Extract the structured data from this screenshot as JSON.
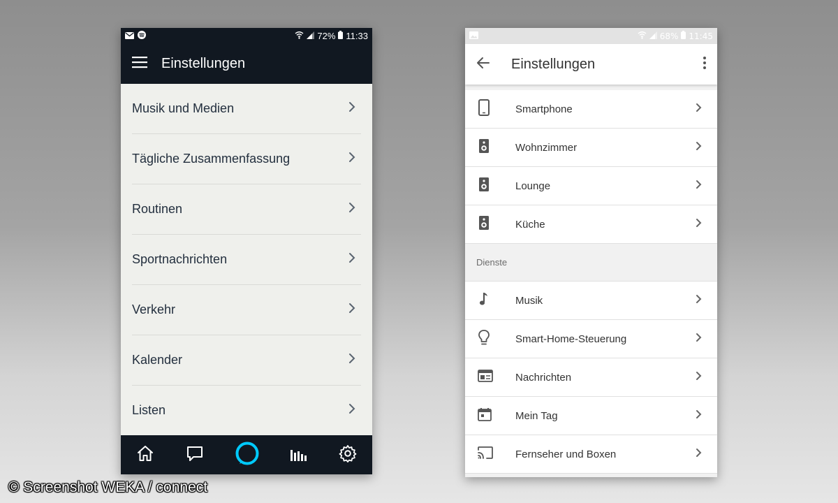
{
  "left_phone": {
    "status": {
      "battery": "72%",
      "time": "11:33"
    },
    "title": "Einstellungen",
    "items": [
      {
        "label": "Musik und Medien"
      },
      {
        "label": "Tägliche Zusammenfassung"
      },
      {
        "label": "Routinen"
      },
      {
        "label": "Sportnachrichten"
      },
      {
        "label": "Verkehr"
      },
      {
        "label": "Kalender"
      },
      {
        "label": "Listen"
      }
    ],
    "nav": [
      "home-icon",
      "chat-icon",
      "alexa-ring-icon",
      "equalizer-icon",
      "gear-icon"
    ],
    "colors": {
      "bar": "#111821",
      "background": "#eff0ec",
      "accent": "#00caff"
    }
  },
  "right_phone": {
    "status": {
      "battery": "68%",
      "time": "11:45"
    },
    "title": "Einstellungen",
    "devices": [
      {
        "label": "Smartphone",
        "icon": "smartphone-icon"
      },
      {
        "label": "Wohnzimmer",
        "icon": "speaker-icon"
      },
      {
        "label": "Lounge",
        "icon": "speaker-icon"
      },
      {
        "label": "Küche",
        "icon": "speaker-icon"
      }
    ],
    "services_header": "Dienste",
    "services": [
      {
        "label": "Musik",
        "icon": "music-note-icon"
      },
      {
        "label": "Smart-Home-Steuerung",
        "icon": "lightbulb-icon"
      },
      {
        "label": "Nachrichten",
        "icon": "news-icon"
      },
      {
        "label": "Mein Tag",
        "icon": "calendar-icon"
      },
      {
        "label": "Fernseher und Boxen",
        "icon": "cast-icon"
      }
    ]
  },
  "watermark": "© Screenshot WEKA / connect"
}
